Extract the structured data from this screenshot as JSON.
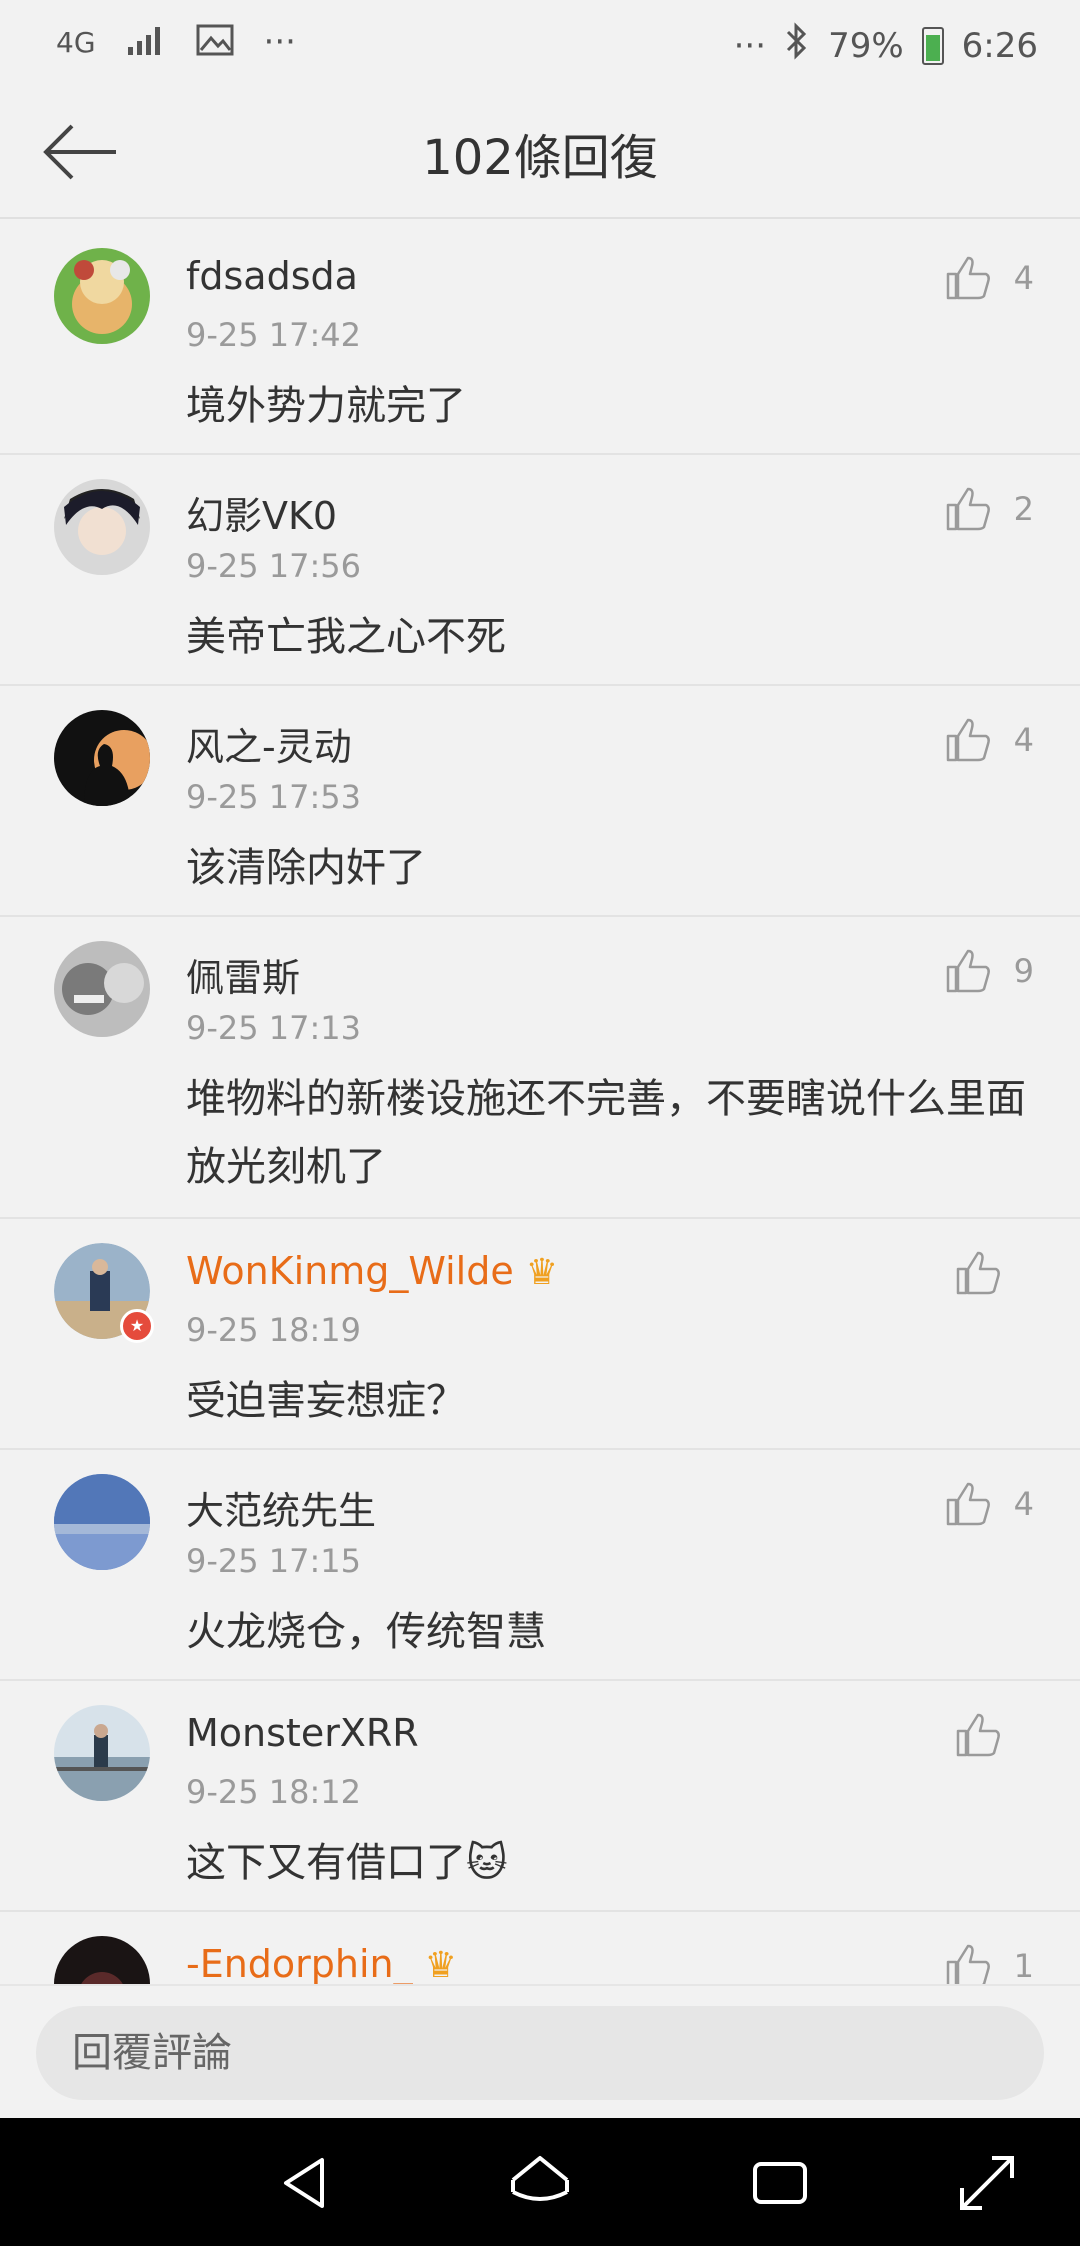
{
  "status_bar": {
    "network": "4G",
    "more_left": "···",
    "more_right": "···",
    "battery": "79%",
    "time": "6:26"
  },
  "header": {
    "title": "102條回復"
  },
  "comments": [
    {
      "username": "fdsadsda",
      "time": "9-25 17:42",
      "text": "境外势力就完了",
      "likes": "4"
    },
    {
      "username": "幻影VK0",
      "time": "9-25 17:56",
      "text": "美帝亡我之心不死",
      "likes": "2"
    },
    {
      "username": "风之-灵动",
      "time": "9-25 17:53",
      "text": "该清除内奸了",
      "likes": "4"
    },
    {
      "username": "佩雷斯",
      "time": "9-25 17:13",
      "text": "堆物料的新楼设施还不完善，不要瞎说什么里面放光刻机了",
      "likes": "9"
    },
    {
      "username": "WonKinmg_Wilde",
      "time": "9-25 18:19",
      "text": "受迫害妄想症？",
      "likes": ""
    },
    {
      "username": "大范统先生",
      "time": "9-25 17:15",
      "text": "火龙烧仓，传统智慧",
      "likes": "4"
    },
    {
      "username": "MonsterXRR",
      "time": "9-25 18:12",
      "text": "这下又有借口了🐱",
      "likes": ""
    },
    {
      "username": "-Endorphin_",
      "time": "",
      "text": "",
      "likes": "1"
    }
  ],
  "reply": {
    "placeholder": "回覆評論"
  },
  "colors": {
    "background": "#f2f2f2",
    "vip_username": "#e86c18",
    "timestamp": "#9a9a9a"
  }
}
